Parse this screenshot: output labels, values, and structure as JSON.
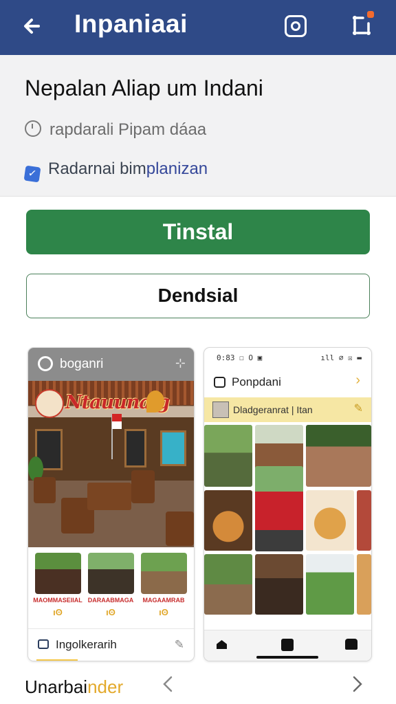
{
  "header": {
    "title": "Inpaniaai",
    "back_icon": "arrow-left-icon",
    "actions": [
      "instagram-icon",
      "share-icon"
    ],
    "color": "#2f4a87"
  },
  "app": {
    "name": "Nepalan Aliap um Indani",
    "meta1": "rapdarali Pipam dáaa",
    "meta2_prefix": "Radarnai bim",
    "meta2_highlight": "planizan"
  },
  "buttons": {
    "primary": "Tinstal",
    "secondary": "Dendsial",
    "primary_color": "#2e8549"
  },
  "screenshot1": {
    "header_title": "boganri",
    "hero_title": "Ntauunaig",
    "thumbs": [
      {
        "caption": "MAOMMASEIIAL",
        "number": "ıʘ"
      },
      {
        "caption": "DARAABMAGA",
        "number": "ıʘ"
      },
      {
        "caption": "MAGAAMRAB",
        "number": "ıʘ"
      }
    ],
    "footer_label": "Ingolkerarih"
  },
  "screenshot2": {
    "status_left": "0:83 ☐ O ▣",
    "status_right": "ıll ⌀ ☒ ▬",
    "header_title": "Ponpdani",
    "banner_text": "Dladgeranrat | Itan"
  },
  "footer": {
    "label_prefix": "Unarbai",
    "label_highlight": "nder"
  }
}
